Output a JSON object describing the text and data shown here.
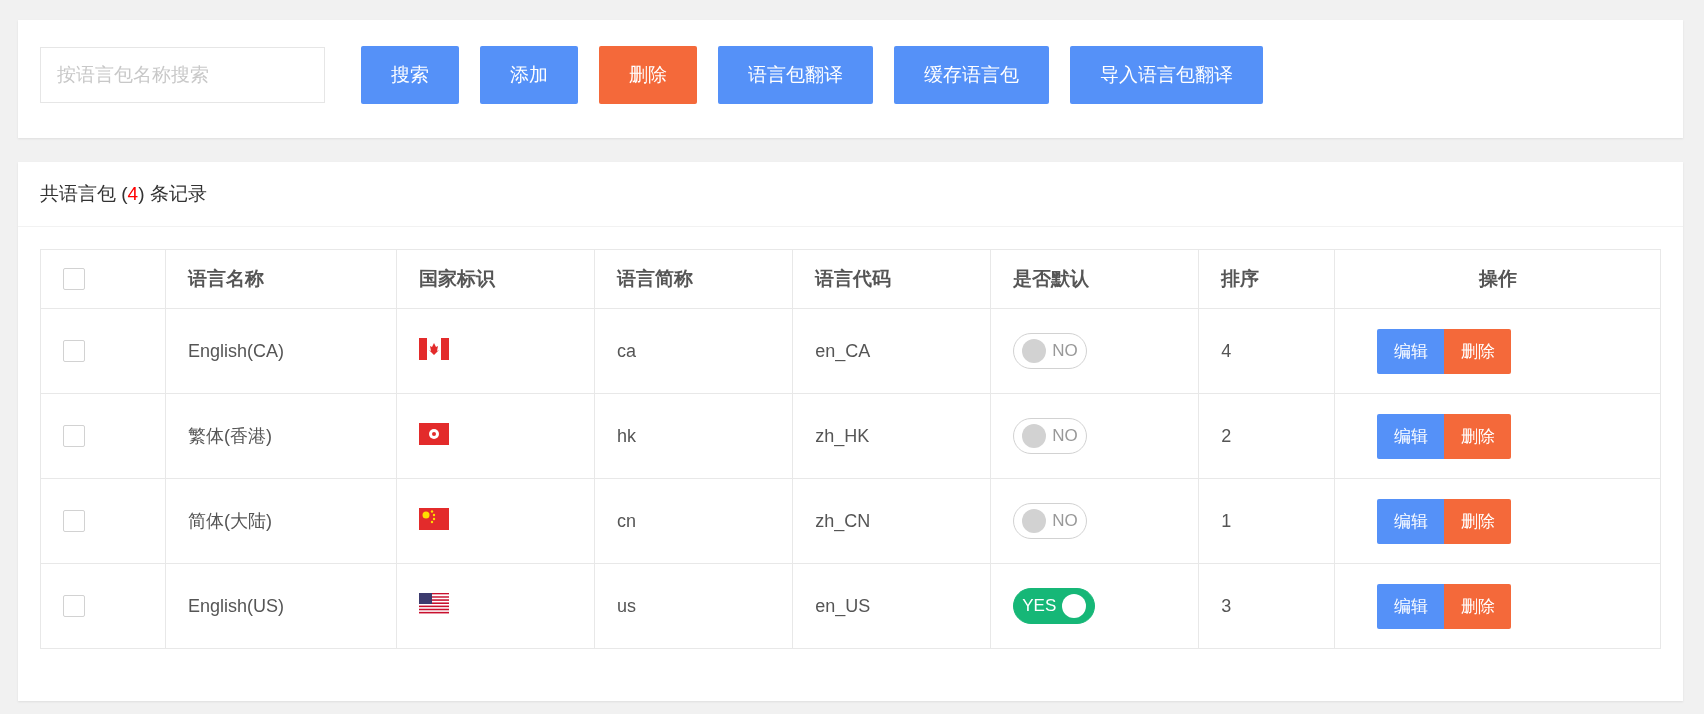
{
  "toolbar": {
    "search": {
      "placeholder": "按语言包名称搜索"
    },
    "buttons": [
      {
        "label": "搜索",
        "kind": "primary"
      },
      {
        "label": "添加",
        "kind": "primary"
      },
      {
        "label": "删除",
        "kind": "danger"
      },
      {
        "label": "语言包翻译",
        "kind": "primary"
      },
      {
        "label": "缓存语言包",
        "kind": "primary"
      },
      {
        "label": "导入语言包翻译",
        "kind": "primary"
      }
    ]
  },
  "summary": {
    "prefix": "共语言包 (",
    "count": "4",
    "suffix": ") 条记录"
  },
  "table": {
    "select_all": {
      "checked": false
    },
    "columns": [
      "语言名称",
      "国家标识",
      "语言简称",
      "语言代码",
      "是否默认",
      "排序",
      "操作"
    ],
    "rows": [
      {
        "checked": false,
        "name": "English(CA)",
        "flag": {
          "kind": "canada"
        },
        "short": "ca",
        "code": "en_CA",
        "default": {
          "on": false,
          "label": "NO"
        },
        "order": "4",
        "actions": [
          "编辑",
          "删除"
        ]
      },
      {
        "checked": false,
        "name": "繁体(香港)",
        "flag": {
          "kind": "hongkong"
        },
        "short": "hk",
        "code": "zh_HK",
        "default": {
          "on": false,
          "label": "NO"
        },
        "order": "2",
        "actions": [
          "编辑",
          "删除"
        ]
      },
      {
        "checked": false,
        "name": "简体(大陆)",
        "flag": {
          "kind": "china"
        },
        "short": "cn",
        "code": "zh_CN",
        "default": {
          "on": false,
          "label": "NO"
        },
        "order": "1",
        "actions": [
          "编辑",
          "删除"
        ]
      },
      {
        "checked": false,
        "name": "English(US)",
        "flag": {
          "kind": "usa"
        },
        "short": "us",
        "code": "en_US",
        "default": {
          "on": true,
          "label": "YES"
        },
        "order": "3",
        "actions": [
          "编辑",
          "删除"
        ]
      }
    ]
  }
}
